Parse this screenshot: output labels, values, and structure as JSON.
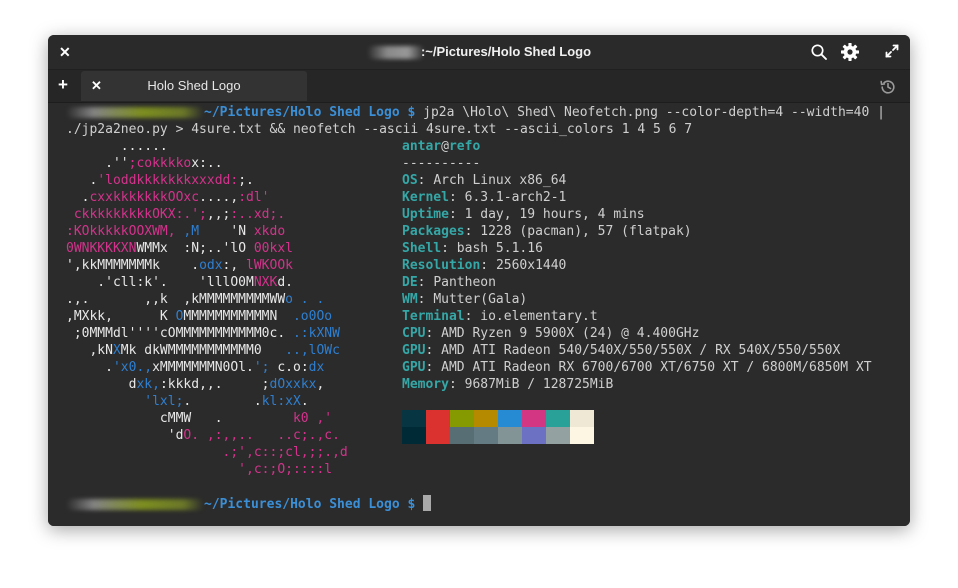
{
  "window": {
    "title": ":~/Pictures/Holo Shed Logo",
    "close_label": "✕",
    "search_icon": "search-icon",
    "gear_icon": "gear-icon",
    "fullscreen_icon": "fullscreen-icon"
  },
  "tabs": {
    "new_tab_label": "+",
    "close_tab_label": "✕",
    "items": [
      {
        "label": "Holo Shed Logo"
      }
    ],
    "history_icon": "history-icon"
  },
  "terminal": {
    "prompt_path": "~/Pictures/Holo Shed Logo $",
    "command_line_1": " jp2a \\Holo\\ Shed\\ Neofetch.png --color-depth=4 --width=40 |",
    "command_line_2_a": "./jp2a2neo.py",
    "command_line_2_b": " > 4sure.txt && neofetch --ascii 4sure.txt --ascii_colors 1 4 5 6 7",
    "art": [
      [
        [
          "c7",
          "       ......"
        ]
      ],
      [
        [
          "c7",
          "     .''"
        ],
        [
          "c5",
          ";cokkkko"
        ],
        [
          "c7",
          "x:.."
        ]
      ],
      [
        [
          "c7",
          "   ."
        ],
        [
          "c5",
          "'loddkkkkkkkxxxdd:"
        ],
        [
          "c7",
          ";."
        ]
      ],
      [
        [
          "c7",
          "  ."
        ],
        [
          "c5",
          "cxxkkkkkkkOOxc"
        ],
        [
          "c7",
          "....,"
        ],
        [
          "c5",
          ":dl'"
        ]
      ],
      [
        [
          "c5",
          " ckkkkkkkkkOKX:.';"
        ],
        [
          "c7",
          ",,;"
        ],
        [
          "c5",
          ":..xd;."
        ]
      ],
      [
        [
          "c5",
          ":KOkkkkkOOXWM, "
        ],
        [
          "c4",
          ",M"
        ],
        [
          "c7",
          "    'N "
        ],
        [
          "c5",
          "xkdo"
        ]
      ],
      [
        [
          "c5",
          "0WNKKKKXN"
        ],
        [
          "c7",
          "WMMx  :N;..'lO "
        ],
        [
          "c5",
          "00kxl"
        ]
      ],
      [
        [
          "c7",
          "',kkMMMMMMMk    ."
        ],
        [
          "c4",
          "odx"
        ],
        [
          "c7",
          ":, "
        ],
        [
          "c5",
          "lWKOOk"
        ]
      ],
      [
        [
          "c7",
          "    .'cll:k'.    'lllO0M"
        ],
        [
          "c5",
          "NXK"
        ],
        [
          "c7",
          "d."
        ]
      ],
      [
        [
          "c7",
          ".,.       ,,k  ,kMMMMMMMMMWW"
        ],
        [
          "c4",
          "o . ."
        ]
      ],
      [
        [
          "c7",
          ",MXkk,      K "
        ],
        [
          "c4",
          "O"
        ],
        [
          "c7",
          "MMMMMMMMMMMN  "
        ],
        [
          "c4",
          ".o0Oo"
        ]
      ],
      [
        [
          "c7",
          " ;0MMMdl''''cOMMMMMMMMMMM0c. "
        ],
        [
          "c4",
          ".:kXNW"
        ]
      ],
      [
        [
          "c7",
          "   ,kN"
        ],
        [
          "c4",
          "X"
        ],
        [
          "c7",
          "Mk dkWMMMMMMMMMMM0   "
        ],
        [
          "c4",
          "..,lOWc"
        ]
      ],
      [
        [
          "c7",
          "     ."
        ],
        [
          "c4",
          "'x0.,"
        ],
        [
          "c7",
          "xMMMMMMMN0Ol."
        ],
        [
          "c4",
          "';"
        ],
        [
          "c7",
          " c.o:"
        ],
        [
          "c4",
          "dx"
        ]
      ],
      [
        [
          "c7",
          "        d"
        ],
        [
          "c4",
          "xk,"
        ],
        [
          "c7",
          ":kkkd,,.     ;"
        ],
        [
          "c4",
          "dOxxkx"
        ],
        [
          "c7",
          ","
        ]
      ],
      [
        [
          "c4",
          "          'lxl;"
        ],
        [
          "c7",
          ".        ."
        ],
        [
          "c4",
          "kl:xX"
        ],
        [
          "c7",
          "."
        ]
      ],
      [
        [
          "c7",
          "            cMMW   .         "
        ],
        [
          "c5",
          "k0 ,'"
        ]
      ],
      [
        [
          "c7",
          "             'd"
        ],
        [
          "c5",
          "O. ,:,,..   ..c;.,c."
        ]
      ],
      [
        [
          "c5",
          "                    .;',c::;cl,;;.,d"
        ]
      ],
      [
        [
          "c5",
          "                      ',c:;O;::::l"
        ]
      ]
    ],
    "info": {
      "user": "antar",
      "at": "@",
      "host": "refo",
      "separator": "----------",
      "fields": [
        {
          "key": "OS",
          "value": "Arch Linux x86_64"
        },
        {
          "key": "Kernel",
          "value": "6.3.1-arch2-1"
        },
        {
          "key": "Uptime",
          "value": "1 day, 19 hours, 4 mins"
        },
        {
          "key": "Packages",
          "value": "1228 (pacman), 57 (flatpak)"
        },
        {
          "key": "Shell",
          "value": "bash 5.1.16"
        },
        {
          "key": "Resolution",
          "value": "2560x1440"
        },
        {
          "key": "DE",
          "value": "Pantheon"
        },
        {
          "key": "WM",
          "value": "Mutter(Gala)"
        },
        {
          "key": "Terminal",
          "value": "io.elementary.t"
        },
        {
          "key": "CPU",
          "value": "AMD Ryzen 9 5900X (24) @ 4.400GHz"
        },
        {
          "key": "GPU",
          "value": "AMD ATI Radeon 540/540X/550/550X / RX 540X/550/550X"
        },
        {
          "key": "GPU",
          "value": "AMD ATI Radeon RX 6700/6700 XT/6750 XT / 6800M/6850M XT"
        },
        {
          "key": "Memory",
          "value": "9687MiB / 128725MiB"
        }
      ]
    },
    "palette_top": [
      "#073642",
      "#dc322f",
      "#859900",
      "#b58900",
      "#268bd2",
      "#d33682",
      "#2aa198",
      "#eee8d5"
    ],
    "palette_bottom": [
      "#002b36",
      "#dc322f",
      "#586e75",
      "#657b83",
      "#839496",
      "#6c71c4",
      "#93a1a1",
      "#fdf6e3"
    ]
  }
}
